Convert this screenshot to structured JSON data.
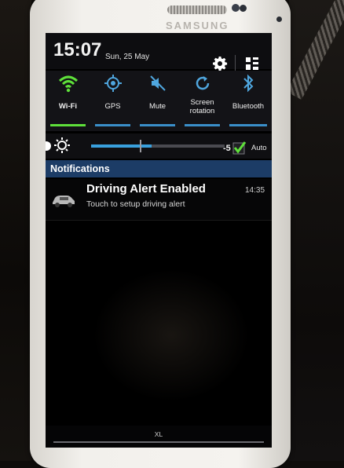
{
  "device": {
    "brand": "SAMSUNG"
  },
  "status": {
    "time": "15:07",
    "date": "Sun, 25 May"
  },
  "quick_settings": [
    {
      "label": "Wi-Fi",
      "icon": "wifi-icon",
      "active": true
    },
    {
      "label": "GPS",
      "icon": "gps-icon",
      "active": false
    },
    {
      "label": "Mute",
      "icon": "mute-icon",
      "active": false
    },
    {
      "label": "Screen rotation",
      "icon": "rotation-icon",
      "active": false
    },
    {
      "label": "Bluetooth",
      "icon": "bluetooth-icon",
      "active": false
    }
  ],
  "brightness": {
    "value": "-5",
    "level": 0.45,
    "auto_label": "Auto",
    "auto_checked": true
  },
  "notifications": {
    "header": "Notifications",
    "items": [
      {
        "title": "Driving Alert Enabled",
        "subtitle": "Touch to setup driving alert",
        "time": "14:35",
        "icon": "car-icon"
      }
    ]
  },
  "bottom": {
    "label": "XL"
  },
  "colors": {
    "active_tile": "#5ee03a",
    "inactive_tile": "#3a8fc9",
    "header_bg": "#1c3c66",
    "slider_fill": "#39a0dd"
  }
}
